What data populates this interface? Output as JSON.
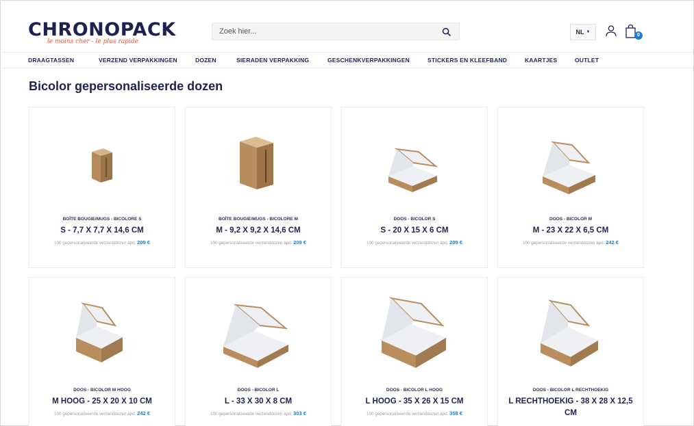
{
  "brand": {
    "name": "CHRONOPACK",
    "tagline": "le moins cher - le plus rapide"
  },
  "search": {
    "placeholder": "Zoek hier..."
  },
  "header": {
    "language": "NL",
    "cart_count": "0"
  },
  "nav": [
    "DRAAGTASSEN",
    "VERZEND VERPAKKINGEN",
    "DOZEN",
    "SIERADEN VERPAKKING",
    "GESCHENKVERPAKKINGEN",
    "STICKERS EN KLEEFBAND",
    "KAARTJES",
    "OUTLET"
  ],
  "page": {
    "title": "Bicolor gepersonaliseerde dozen"
  },
  "price_prefix": "100 gepersonaliseerde verzenddozen àpd.",
  "products": [
    {
      "category": "BOÎTE BOUGIE/MUGS - BICOLORE S",
      "name": "S - 7,7 X 7,7 X 14,6 CM",
      "price": "209 €"
    },
    {
      "category": "BOÎTE BOUGIE/MUGS - BICOLORE M",
      "name": "M - 9,2 X 9,2 X 14,6 CM",
      "price": "209 €"
    },
    {
      "category": "DOOS - BICOLOR S",
      "name": "S - 20 X 15 X 6 CM",
      "price": "209 €"
    },
    {
      "category": "DOOS - BICOLOR M",
      "name": "M - 23 X 22 X 6,5 CM",
      "price": "242 €"
    },
    {
      "category": "DOOS - BICOLOR M HOOG",
      "name": "M HOOG - 25 X 20 X 10 CM",
      "price": "242 €"
    },
    {
      "category": "DOOS - BICOLOR L",
      "name": "L - 33 X 30 X 8 CM",
      "price": "303 €"
    },
    {
      "category": "DOOS - BICOLOR L HOOG",
      "name": "L HOOG - 35 X 26 X 15 CM",
      "price": "358 €"
    },
    {
      "category": "DOOS - BICOLOR L RECHTHOEKIG",
      "name": "L RECHTHOEKIG - 38 X 28 X 12,5 CM",
      "price": ""
    }
  ],
  "colors": {
    "navy": "#1f2250",
    "accent_blue": "#1a7fd0",
    "logo_tagline": "#e8553a",
    "kraft": "#b98d5e",
    "box_interior": "#eef0f3"
  }
}
